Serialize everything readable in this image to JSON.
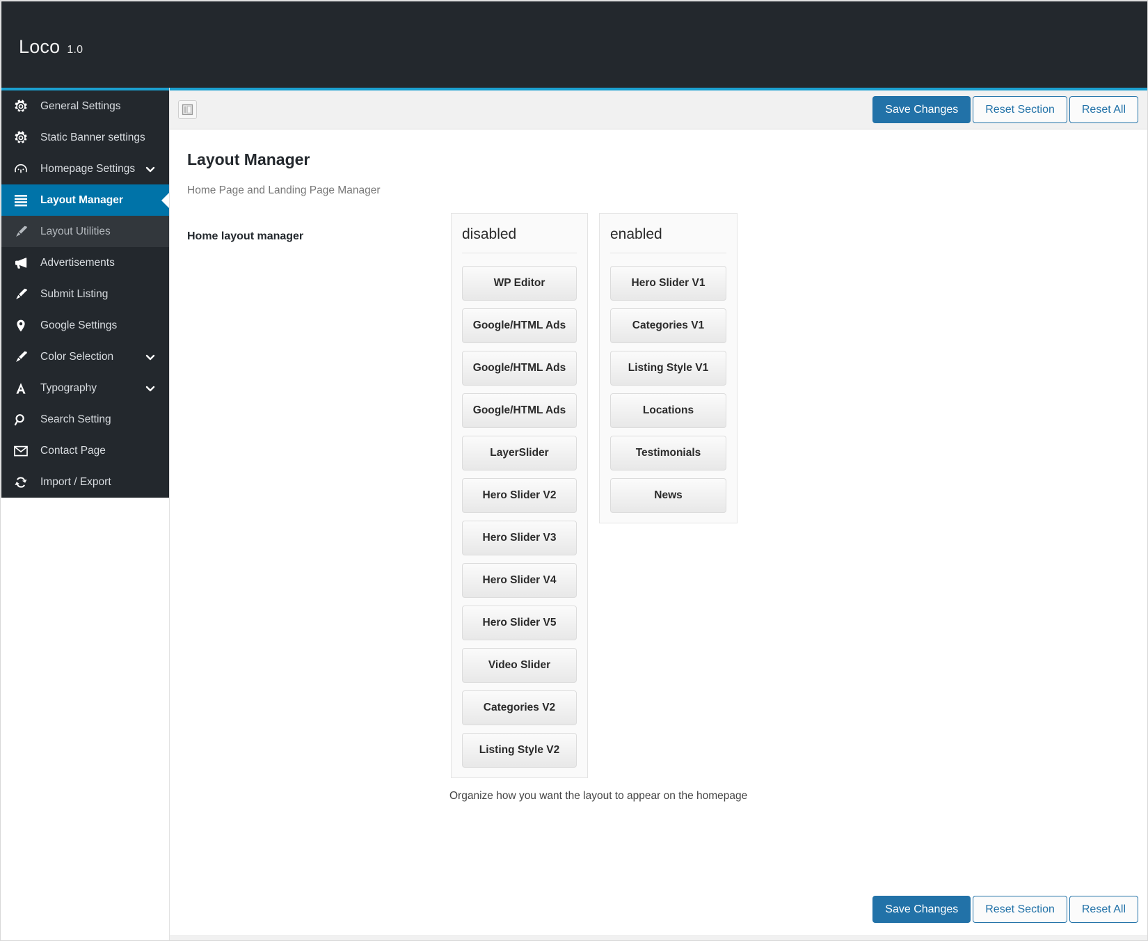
{
  "topbar": {
    "brand": "Loco",
    "version": "1.0"
  },
  "sidebar": {
    "items": [
      {
        "label": "General Settings",
        "icon": "gear-icon",
        "state": "normal",
        "chevron": false
      },
      {
        "label": "Static Banner settings",
        "icon": "gear-icon",
        "state": "normal",
        "chevron": false
      },
      {
        "label": "Homepage Settings",
        "icon": "dashboard-icon",
        "state": "normal",
        "chevron": true
      },
      {
        "label": "Layout Manager",
        "icon": "menu-lines-icon",
        "state": "active",
        "chevron": false
      },
      {
        "label": "Layout Utilities",
        "icon": "brush-icon",
        "state": "sub",
        "chevron": false
      },
      {
        "label": "Advertisements",
        "icon": "megaphone-icon",
        "state": "normal",
        "chevron": false
      },
      {
        "label": "Submit Listing",
        "icon": "brush-icon",
        "state": "normal",
        "chevron": false
      },
      {
        "label": "Google Settings",
        "icon": "map-pin-icon",
        "state": "normal",
        "chevron": false
      },
      {
        "label": "Color Selection",
        "icon": "brush-icon",
        "state": "normal",
        "chevron": true
      },
      {
        "label": "Typography",
        "icon": "letter-a-icon",
        "state": "normal",
        "chevron": true
      },
      {
        "label": "Search Setting",
        "icon": "search-icon",
        "state": "normal",
        "chevron": false
      },
      {
        "label": "Contact Page",
        "icon": "envelope-icon",
        "state": "normal",
        "chevron": false
      },
      {
        "label": "Import / Export",
        "icon": "refresh-icon",
        "state": "normal",
        "chevron": false
      }
    ]
  },
  "toolbar": {
    "expand_icon": "layout-toggle-icon",
    "save_label": "Save Changes",
    "reset_section_label": "Reset Section",
    "reset_all_label": "Reset All"
  },
  "main": {
    "title": "Layout Manager",
    "subtitle": "Home Page and Landing Page Manager",
    "field_label": "Home layout manager",
    "description": "Organize how you want the layout to appear on the homepage"
  },
  "sorter": {
    "disabled": {
      "title": "disabled",
      "items": [
        "WP Editor",
        "Google/HTML Ads",
        "Google/HTML Ads",
        "Google/HTML Ads",
        "LayerSlider",
        "Hero Slider V2",
        "Hero Slider V3",
        "Hero Slider V4",
        "Hero Slider V5",
        "Video Slider",
        "Categories V2",
        "Listing Style V2"
      ]
    },
    "enabled": {
      "title": "enabled",
      "items": [
        "Hero Slider V1",
        "Categories V1",
        "Listing Style V1",
        "Locations",
        "Testimonials",
        "News"
      ]
    }
  },
  "footer": {
    "save_label": "Save Changes",
    "reset_section_label": "Reset Section",
    "reset_all_label": "Reset All"
  },
  "colors": {
    "topbar_bg": "#23282d",
    "accent": "#1ba0d0",
    "active_nav": "#0073a8",
    "primary_button": "#2272a8"
  }
}
